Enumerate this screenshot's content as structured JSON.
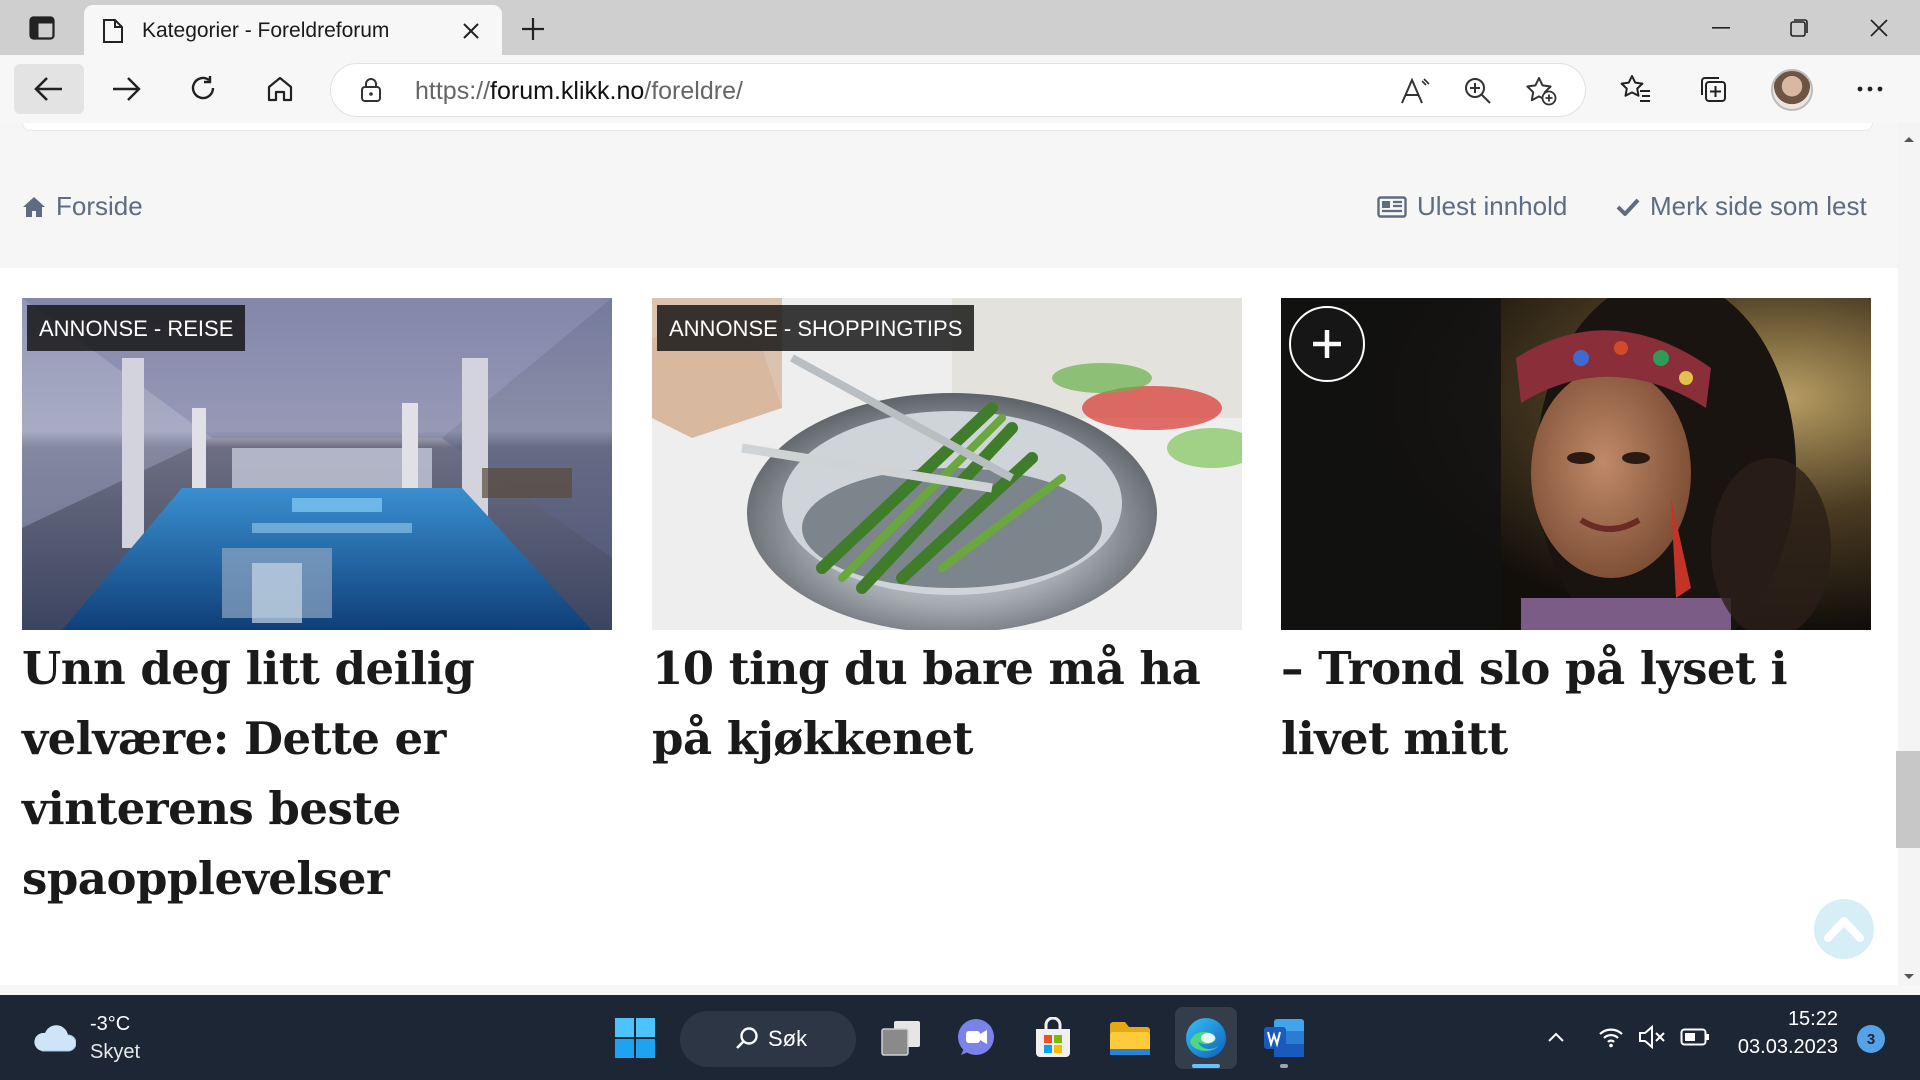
{
  "browser": {
    "tab_title": "Kategorier - Foreldreforum",
    "url_prefix": "https://",
    "url_host": "forum.klikk.no",
    "url_path": "/foreldre/"
  },
  "nav": {
    "home_label": "Forside",
    "unread_label": "Ulest innhold",
    "mark_read_label": "Merk side som lest"
  },
  "cards": [
    {
      "badge": "ANNONSE - REISE",
      "headline": "Unn deg litt deilig velvære: Dette er vinterens beste spaopplevelser",
      "image": "spa-pool-photo"
    },
    {
      "badge": "ANNONSE - SHOPPINGTIPS",
      "headline": "10 ting du bare må ha på kjøkkenet",
      "image": "asparagus-pan-photo"
    },
    {
      "badge": "",
      "headline": "– Trond slo på lyset i livet mitt",
      "image": "woman-portrait-photo"
    }
  ],
  "taskbar": {
    "weather_temp": "-3°C",
    "weather_desc": "Skyet",
    "search_label": "Søk",
    "time": "15:22",
    "date": "03.03.2023",
    "notification_count": "3"
  },
  "colors": {
    "taskbar_bg": "#1c2634",
    "nav_text": "#5d6c80",
    "badge_bg": "#161616",
    "edge_blue": "#0f7bd8"
  }
}
